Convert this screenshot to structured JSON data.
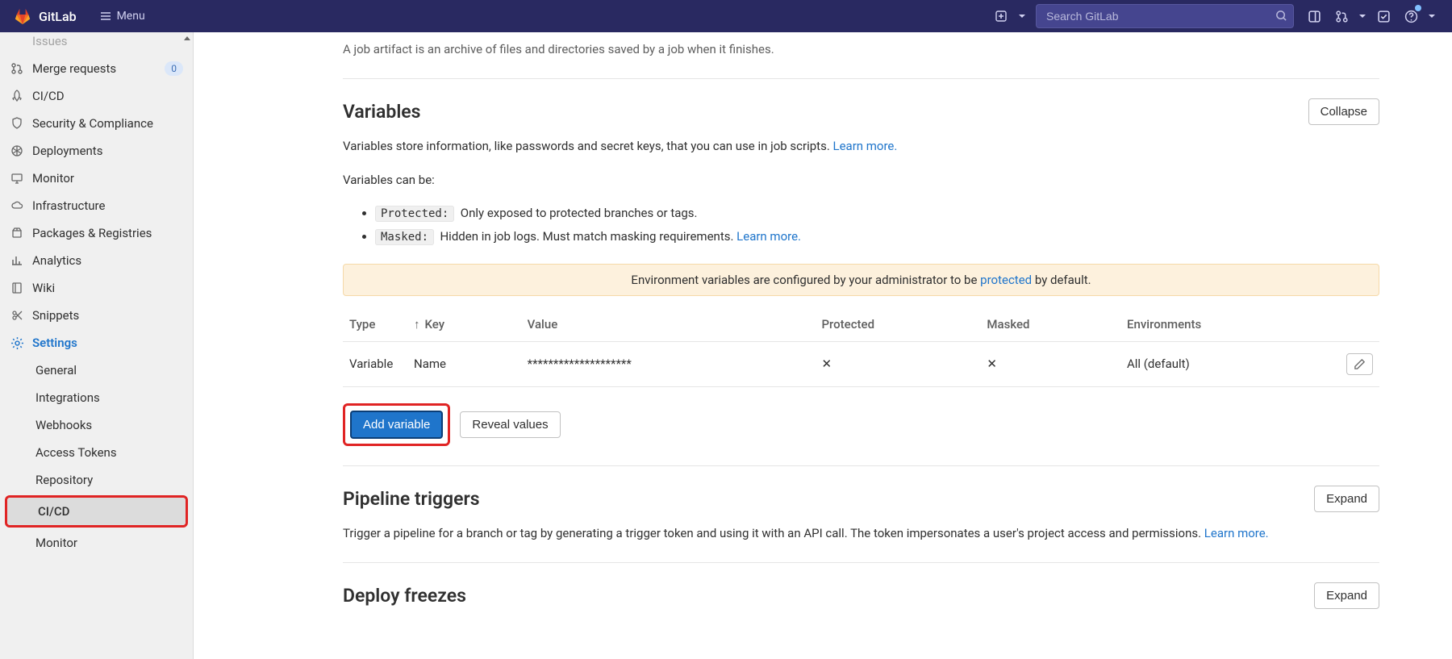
{
  "header": {
    "brand": "GitLab",
    "menu_label": "Menu",
    "search_placeholder": "Search GitLab"
  },
  "sidebar": {
    "items": [
      {
        "label": "Issues",
        "badge": ""
      },
      {
        "label": "Merge requests",
        "badge": "0"
      },
      {
        "label": "CI/CD"
      },
      {
        "label": "Security & Compliance"
      },
      {
        "label": "Deployments"
      },
      {
        "label": "Monitor"
      },
      {
        "label": "Infrastructure"
      },
      {
        "label": "Packages & Registries"
      },
      {
        "label": "Analytics"
      },
      {
        "label": "Wiki"
      },
      {
        "label": "Snippets"
      },
      {
        "label": "Settings"
      }
    ],
    "settings_sub": [
      {
        "label": "General"
      },
      {
        "label": "Integrations"
      },
      {
        "label": "Webhooks"
      },
      {
        "label": "Access Tokens"
      },
      {
        "label": "Repository"
      },
      {
        "label": "CI/CD",
        "active": true
      },
      {
        "label": "Monitor"
      }
    ]
  },
  "content": {
    "artifacts_desc": "A job artifact is an archive of files and directories saved by a job when it finishes.",
    "variables": {
      "title": "Variables",
      "collapse_label": "Collapse",
      "desc": "Variables store information, like passwords and secret keys, that you can use in job scripts. ",
      "learn_more": "Learn more.",
      "can_be": "Variables can be:",
      "protected_tag": "Protected:",
      "protected_txt": "Only exposed to protected branches or tags.",
      "masked_tag": "Masked:",
      "masked_txt": "Hidden in job logs. Must match masking requirements. ",
      "masked_learn": "Learn more.",
      "warn_pre": "Environment variables are configured by your administrator to be ",
      "warn_link": "protected",
      "warn_post": " by default.",
      "cols": {
        "type": "Type",
        "key": "Key",
        "value": "Value",
        "protected": "Protected",
        "masked": "Masked",
        "env": "Environments"
      },
      "row": {
        "type": "Variable",
        "key": "Name",
        "value": "********************",
        "protected": "✕",
        "masked": "✕",
        "env": "All (default)"
      },
      "add_btn": "Add variable",
      "reveal_btn": "Reveal values"
    },
    "triggers": {
      "title": "Pipeline triggers",
      "expand": "Expand",
      "desc": "Trigger a pipeline for a branch or tag by generating a trigger token and using it with an API call. The token impersonates a user's project access and permissions. ",
      "learn": "Learn more."
    },
    "freezes": {
      "title": "Deploy freezes",
      "expand": "Expand"
    }
  }
}
